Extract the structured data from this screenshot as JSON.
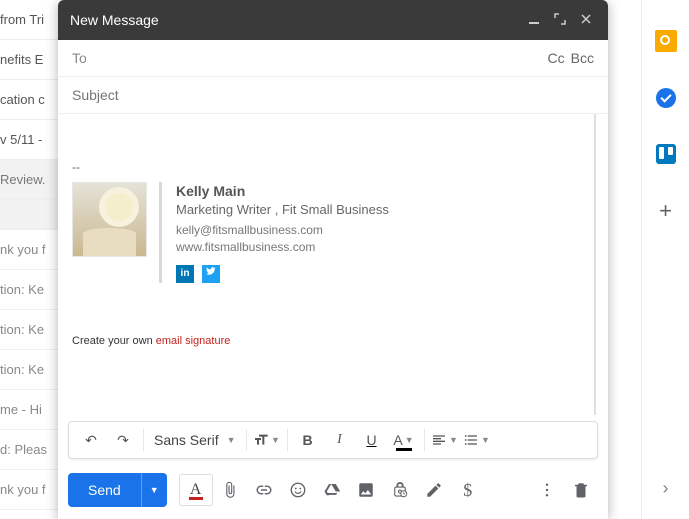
{
  "compose": {
    "title": "New Message",
    "to_label": "To",
    "cc_label": "Cc",
    "bcc_label": "Bcc",
    "subject_placeholder": "Subject",
    "sig_separator": "--",
    "font_label": "Sans Serif",
    "send_label": "Send",
    "promo_text": "Create your own ",
    "promo_link": "email signature"
  },
  "signature": {
    "name": "Kelly Main",
    "title": "Marketing Writer , Fit Small Business",
    "email": "kelly@fitsmallbusiness.com",
    "website": "www.fitsmallbusiness.com",
    "social": {
      "linkedin": "in",
      "twitter": "t"
    }
  },
  "fmt_icons": {
    "undo": "↶",
    "redo": "↷",
    "bold": "B",
    "italic": "I",
    "underline": "U",
    "color": "A"
  },
  "inbox_rows": [
    "from Tri",
    "nefits E",
    "cation c",
    "v 5/11 -",
    "Review.",
    "nk you f",
    "tion: Ke",
    "tion: Ke",
    "tion: Ke",
    "me - Hi",
    "d: Pleas",
    "nk you f"
  ]
}
